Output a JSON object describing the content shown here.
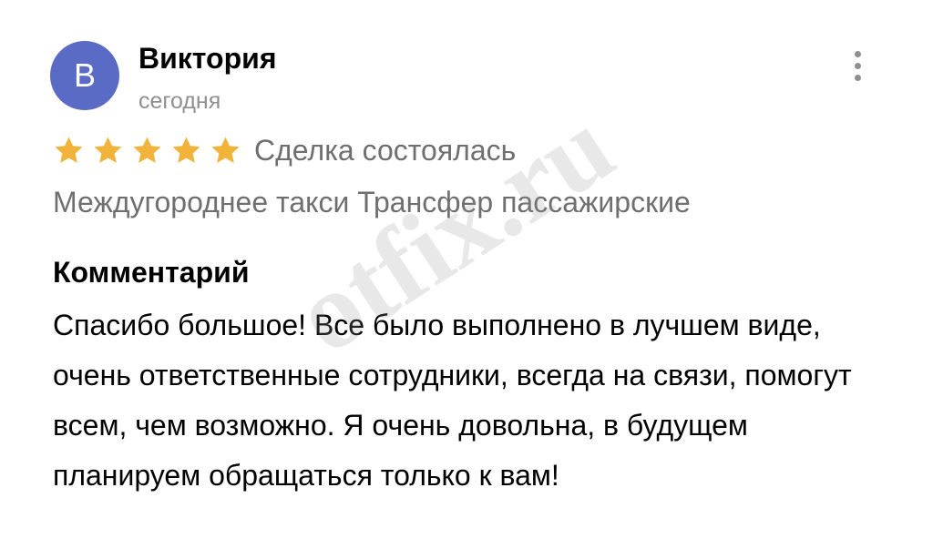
{
  "review": {
    "avatar_letter": "В",
    "author_name": "Виктория",
    "date": "сегодня",
    "more_icon": "more-vertical-icon",
    "rating": {
      "value": 5,
      "max": 5,
      "star_color": "#f2b33a"
    },
    "deal_status": "Сделка состоялась",
    "category": "Междугороднее такси Трансфер пассажирские",
    "comment_heading": "Комментарий",
    "comment_text": "Спасибо большое! Все было выполнено в лучшем виде, очень ответственные сотрудники, всегда на связи, помогут всем, чем возможно. Я очень довольна, в будущем планируем обращаться только к вам!"
  },
  "watermark": "otfix.ru",
  "colors": {
    "avatar_bg": "#5a6bc6",
    "secondary_text": "#8f8f8f",
    "muted_text": "#6f6f6f"
  }
}
